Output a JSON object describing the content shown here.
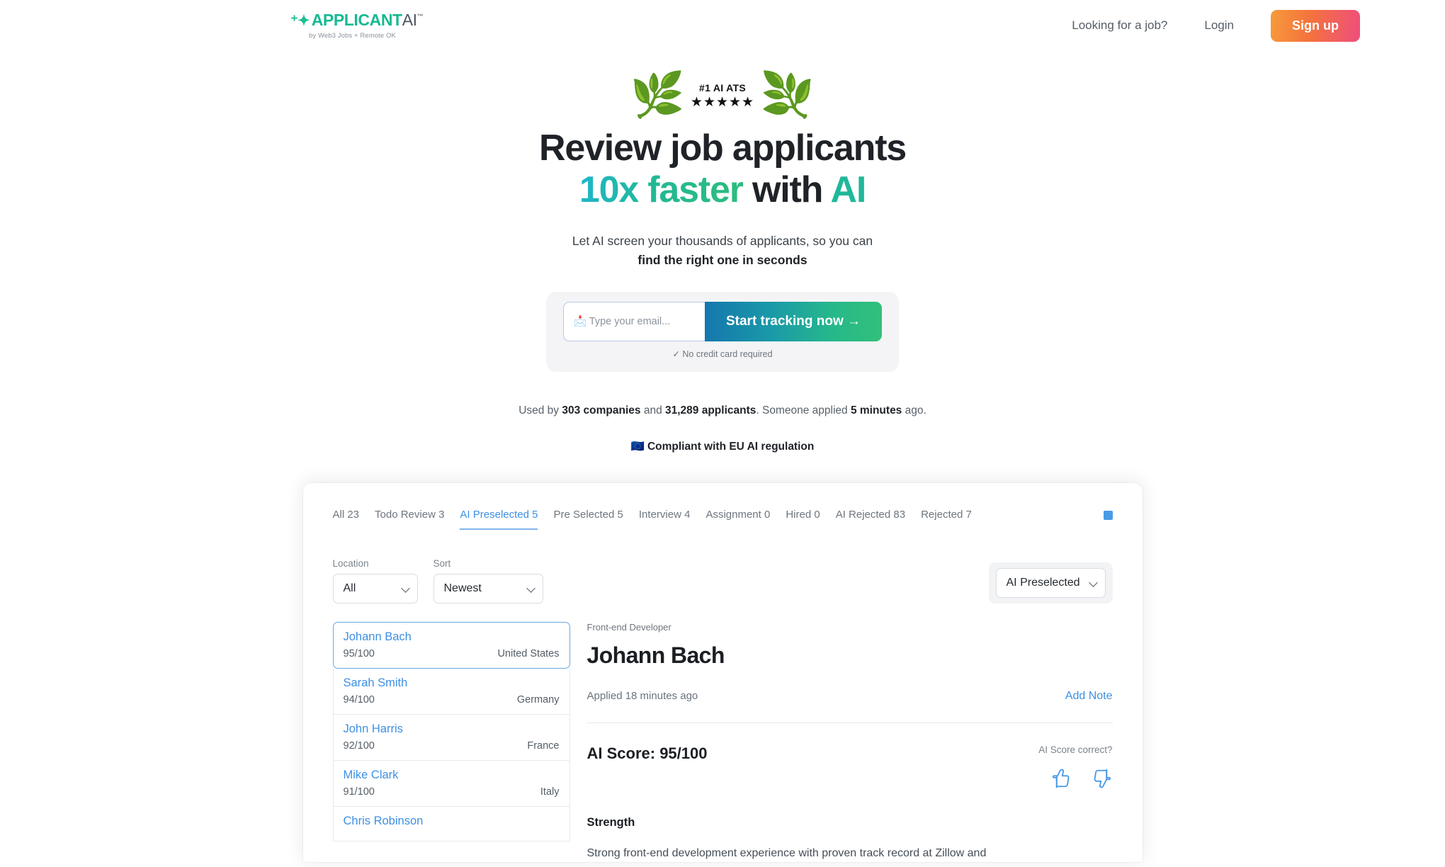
{
  "header": {
    "logo": {
      "spark_icon": "sparkle-icon",
      "name_primary": "APPLICANT",
      "name_secondary": "AI",
      "trademark": "™",
      "tagline": "by Web3 Jobs + Remote OK"
    },
    "nav": [
      {
        "label": "Looking for a job?",
        "name": "looking-for-job-link"
      },
      {
        "label": "Login",
        "name": "login-link"
      }
    ],
    "signup_label": "Sign up"
  },
  "hero": {
    "badge": {
      "text": "#1 AI ATS",
      "stars": "★★★★★",
      "laurel_icon": "laurel-wreath-icon"
    },
    "headline_line1": "Review job applicants",
    "headline_10x": "10x faster",
    "headline_with": " with ",
    "headline_ai": "AI",
    "subtitle_line1": "Let AI screen your thousands of applicants, so you can",
    "subtitle_line2": "find the right one in seconds",
    "email_placeholder": "📩 Type your email...",
    "email_value": "",
    "cta_label": "Start tracking now →",
    "no_credit_card": "✓ No credit card required",
    "social_proof": {
      "prefix": "Used by ",
      "companies": "303 companies",
      "middle": " and ",
      "applicants": "31,289 applicants",
      "suffix_pre": ". Someone applied ",
      "time": "5 minutes",
      "suffix_post": " ago."
    },
    "compliance": {
      "flag": "🇪🇺",
      "text": "Compliant with EU AI regulation"
    }
  },
  "app": {
    "tabs": [
      {
        "label": "All 23",
        "name": "tab-all",
        "active": false
      },
      {
        "label": "Todo Review 3",
        "name": "tab-todo-review",
        "active": false
      },
      {
        "label": "AI Preselected 5",
        "name": "tab-ai-preselected",
        "active": true
      },
      {
        "label": "Pre Selected 5",
        "name": "tab-pre-selected",
        "active": false
      },
      {
        "label": "Interview 4",
        "name": "tab-interview",
        "active": false
      },
      {
        "label": "Assignment 0",
        "name": "tab-assignment",
        "active": false
      },
      {
        "label": "Hired 0",
        "name": "tab-hired",
        "active": false
      },
      {
        "label": "AI Rejected 83",
        "name": "tab-ai-rejected",
        "active": false
      },
      {
        "label": "Rejected 7",
        "name": "tab-rejected",
        "active": false
      }
    ],
    "grid_view_icon": "grid-view-icon",
    "filters": {
      "location_label": "Location",
      "location_value": "All",
      "sort_label": "Sort",
      "sort_value": "Newest",
      "stage_value": "AI Preselected"
    },
    "candidates": [
      {
        "name": "Johann Bach",
        "score": "95/100",
        "location": "United States",
        "selected": true
      },
      {
        "name": "Sarah Smith",
        "score": "94/100",
        "location": "Germany",
        "selected": false
      },
      {
        "name": "John Harris",
        "score": "92/100",
        "location": "France",
        "selected": false
      },
      {
        "name": "Mike Clark",
        "score": "91/100",
        "location": "Italy",
        "selected": false
      },
      {
        "name": "Chris Robinson",
        "score": "",
        "location": "",
        "selected": false
      }
    ],
    "detail": {
      "role": "Front-end Developer",
      "name": "Johann Bach",
      "applied": "Applied 18 minutes ago",
      "add_note_label": "Add Note",
      "score_title": "AI Score: 95/100",
      "score_feedback_label": "AI Score correct?",
      "thumb_up_icon": "thumbs-up-icon",
      "thumb_down_icon": "thumbs-down-icon",
      "strength_title": "Strength",
      "strength_text": "Strong front-end development experience with proven track record at Zillow and"
    }
  },
  "colors": {
    "teal": "#20b899",
    "blue": "#3d90e3",
    "orange": "#f79a3c",
    "pink": "#ef4e7c"
  }
}
